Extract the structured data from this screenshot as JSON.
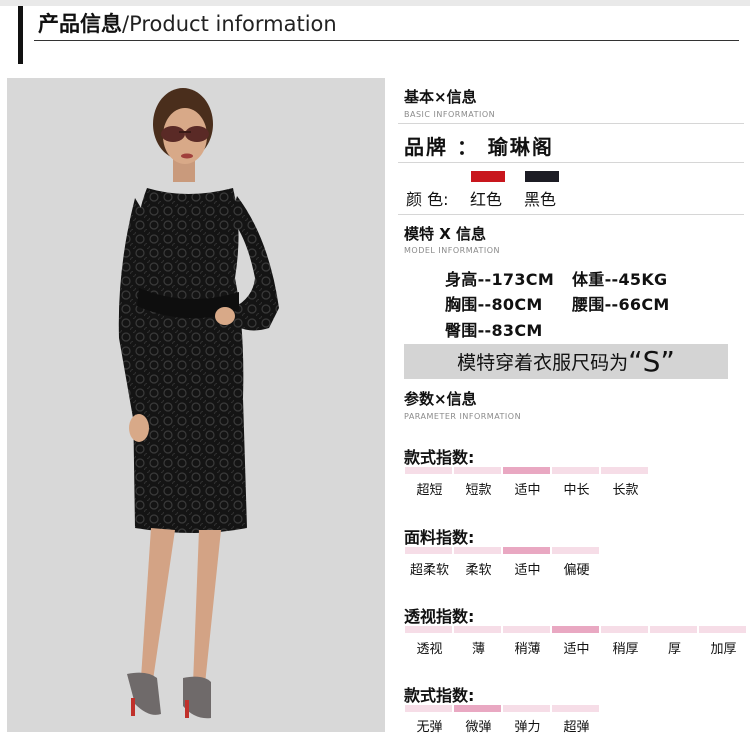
{
  "header": {
    "title_cn": "产品信息",
    "separator": "/",
    "title_en": "Product information"
  },
  "photo": {
    "icon": "model-photo"
  },
  "basic": {
    "title": "基本×信息",
    "subtitle": "BASIC INFORMATION",
    "brand": "品牌 ： 瑜琳阁",
    "color_label": "颜 色:",
    "colors": [
      {
        "name": "红色",
        "hex": "#c8161d"
      },
      {
        "name": "黑色",
        "hex": "#1c1c24"
      }
    ]
  },
  "model": {
    "title": "模特 X 信息",
    "subtitle": "MODEL INFORMATION",
    "height": "身高--173CM",
    "weight": "体重--45KG",
    "bust": "胸围--80CM",
    "waist": "腰围--66CM",
    "hip": "臀围--83CM",
    "size_text": "模特穿着衣服尺码为",
    "size_value": "“S”"
  },
  "params": {
    "title": "参数×信息",
    "subtitle": "PARAMETER INFORMATION"
  },
  "indices": [
    {
      "title": "款式指数:",
      "labels": [
        "超短",
        "短款",
        "适中",
        "中长",
        "长款"
      ],
      "active": 2
    },
    {
      "title": "面料指数:",
      "labels": [
        "超柔软",
        "柔软",
        "适中",
        "偏硬"
      ],
      "active": 2
    },
    {
      "title": "透视指数:",
      "labels": [
        "透视",
        "薄",
        "稍薄",
        "适中",
        "稍厚",
        "厚",
        "加厚"
      ],
      "active": 3
    },
    {
      "title": "款式指数:",
      "labels": [
        "无弹",
        "微弹",
        "弹力",
        "超弹"
      ],
      "active": 1
    }
  ],
  "accent_pink": "#e9a8c2",
  "light_pink": "#f6dde7"
}
